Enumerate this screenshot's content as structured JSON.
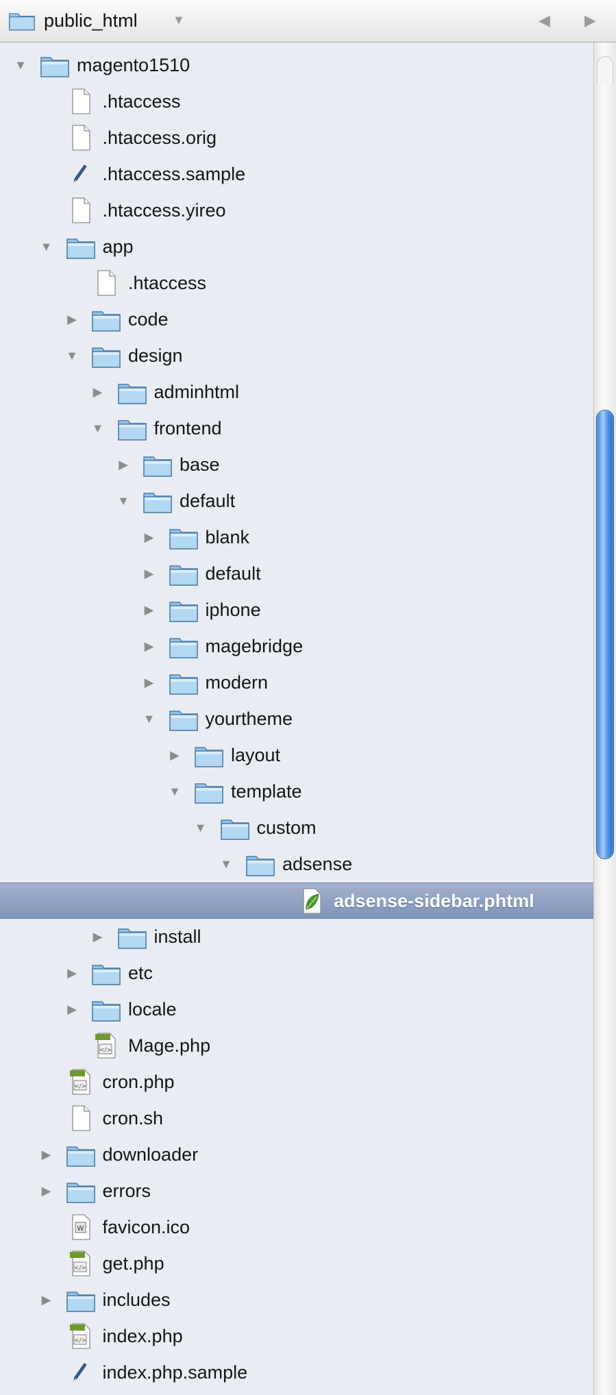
{
  "header": {
    "title": "public_html",
    "folder_icon": "folder-icon",
    "menu_chevron": "▼",
    "back_glyph": "◀",
    "forward_glyph": "▶"
  },
  "colors": {
    "folder_blue": "#8fc3ea",
    "selection": "#8a9dbf",
    "scrollbar_thumb": "#4a90e2",
    "php_green": "#6f9a2e"
  },
  "tree": [
    {
      "label": "magento1510",
      "icon": "folder",
      "expanded": true,
      "has_children": true,
      "depth": 0
    },
    {
      "label": ".htaccess",
      "icon": "file",
      "depth": 1
    },
    {
      "label": ".htaccess.orig",
      "icon": "file",
      "depth": 1
    },
    {
      "label": ".htaccess.sample",
      "icon": "script",
      "depth": 1
    },
    {
      "label": ".htaccess.yireo",
      "icon": "file",
      "depth": 1
    },
    {
      "label": "app",
      "icon": "folder",
      "expanded": true,
      "has_children": true,
      "depth": 1
    },
    {
      "label": ".htaccess",
      "icon": "file",
      "depth": 2
    },
    {
      "label": "code",
      "icon": "folder",
      "expanded": false,
      "has_children": true,
      "depth": 2
    },
    {
      "label": "design",
      "icon": "folder",
      "expanded": true,
      "has_children": true,
      "depth": 2
    },
    {
      "label": "adminhtml",
      "icon": "folder",
      "expanded": false,
      "has_children": true,
      "depth": 3
    },
    {
      "label": "frontend",
      "icon": "folder",
      "expanded": true,
      "has_children": true,
      "depth": 3
    },
    {
      "label": "base",
      "icon": "folder",
      "expanded": false,
      "has_children": true,
      "depth": 4
    },
    {
      "label": "default",
      "icon": "folder",
      "expanded": true,
      "has_children": true,
      "depth": 4
    },
    {
      "label": "blank",
      "icon": "folder",
      "expanded": false,
      "has_children": true,
      "depth": 5
    },
    {
      "label": "default",
      "icon": "folder",
      "expanded": false,
      "has_children": true,
      "depth": 5
    },
    {
      "label": "iphone",
      "icon": "folder",
      "expanded": false,
      "has_children": true,
      "depth": 5
    },
    {
      "label": "magebridge",
      "icon": "folder",
      "expanded": false,
      "has_children": true,
      "depth": 5
    },
    {
      "label": "modern",
      "icon": "folder",
      "expanded": false,
      "has_children": true,
      "depth": 5
    },
    {
      "label": "yourtheme",
      "icon": "folder",
      "expanded": true,
      "has_children": true,
      "depth": 5
    },
    {
      "label": "layout",
      "icon": "folder",
      "expanded": false,
      "has_children": true,
      "depth": 6
    },
    {
      "label": "template",
      "icon": "folder",
      "expanded": true,
      "has_children": true,
      "depth": 6
    },
    {
      "label": "custom",
      "icon": "folder",
      "expanded": true,
      "has_children": true,
      "depth": 7
    },
    {
      "label": "adsense",
      "icon": "folder",
      "expanded": true,
      "has_children": true,
      "depth": 8
    },
    {
      "label": "adsense-sidebar.phtml",
      "icon": "leaf",
      "selected": true,
      "depth": 10
    },
    {
      "label": "install",
      "icon": "folder",
      "expanded": false,
      "has_children": true,
      "depth": 3
    },
    {
      "label": "etc",
      "icon": "folder",
      "expanded": false,
      "has_children": true,
      "depth": 2
    },
    {
      "label": "locale",
      "icon": "folder",
      "expanded": false,
      "has_children": true,
      "depth": 2
    },
    {
      "label": "Mage.php",
      "icon": "php",
      "depth": 2
    },
    {
      "label": "cron.php",
      "icon": "php",
      "depth": 1
    },
    {
      "label": "cron.sh",
      "icon": "file",
      "depth": 1
    },
    {
      "label": "downloader",
      "icon": "folder",
      "expanded": false,
      "has_children": true,
      "depth": 1
    },
    {
      "label": "errors",
      "icon": "folder",
      "expanded": false,
      "has_children": true,
      "depth": 1
    },
    {
      "label": "favicon.ico",
      "icon": "ico",
      "depth": 1
    },
    {
      "label": "get.php",
      "icon": "php",
      "depth": 1
    },
    {
      "label": "includes",
      "icon": "folder",
      "expanded": false,
      "has_children": true,
      "depth": 1
    },
    {
      "label": "index.php",
      "icon": "php",
      "depth": 1
    },
    {
      "label": "index.php.sample",
      "icon": "script",
      "depth": 1
    }
  ]
}
